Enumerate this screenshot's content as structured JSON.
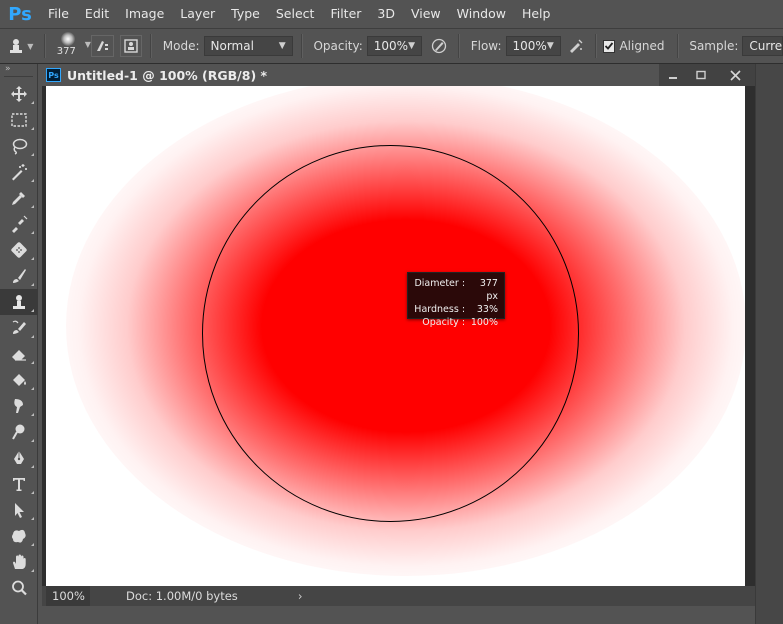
{
  "app": {
    "logo": "Ps"
  },
  "menu": {
    "items": [
      "File",
      "Edit",
      "Image",
      "Layer",
      "Type",
      "Select",
      "Filter",
      "3D",
      "View",
      "Window",
      "Help"
    ]
  },
  "options": {
    "brush_size": "377",
    "mode_label": "Mode:",
    "mode_value": "Normal",
    "opacity_label": "Opacity:",
    "opacity_value": "100%",
    "flow_label": "Flow:",
    "flow_value": "100%",
    "aligned_label": "Aligned",
    "aligned_checked": true,
    "sample_label": "Sample:",
    "sample_value": "Current"
  },
  "document": {
    "ps_badge": "Ps",
    "title": "Untitled-1 @ 100% (RGB/8) *",
    "window_controls": [
      "minimize-icon",
      "restore-icon",
      "close-icon"
    ],
    "zoom": "100%",
    "doc_info": "Doc: 1.00M/0 bytes",
    "paint_color": "#ff0000"
  },
  "tooltip": {
    "rows": [
      {
        "key": "Diameter",
        "value": "377 px"
      },
      {
        "key": "Hardness",
        "value": "33%"
      },
      {
        "key": "Opacity",
        "value": "100%"
      }
    ]
  },
  "tools": [
    "move-tool-icon",
    "marquee-tool-icon",
    "lasso-tool-icon",
    "magic-wand-tool-icon",
    "eyedropper-tool-icon",
    "spot-healing-tool-icon",
    "patch-tool-icon",
    "brush-tool-icon",
    "clone-stamp-tool-icon",
    "history-brush-tool-icon",
    "eraser-tool-icon",
    "paint-bucket-tool-icon",
    "smudge-tool-icon",
    "dodge-tool-icon",
    "pen-tool-icon",
    "type-tool-icon",
    "path-selection-tool-icon",
    "custom-shape-tool-icon",
    "hand-tool-icon",
    "zoom-tool-icon"
  ],
  "active_tool": "clone-stamp-tool-icon"
}
